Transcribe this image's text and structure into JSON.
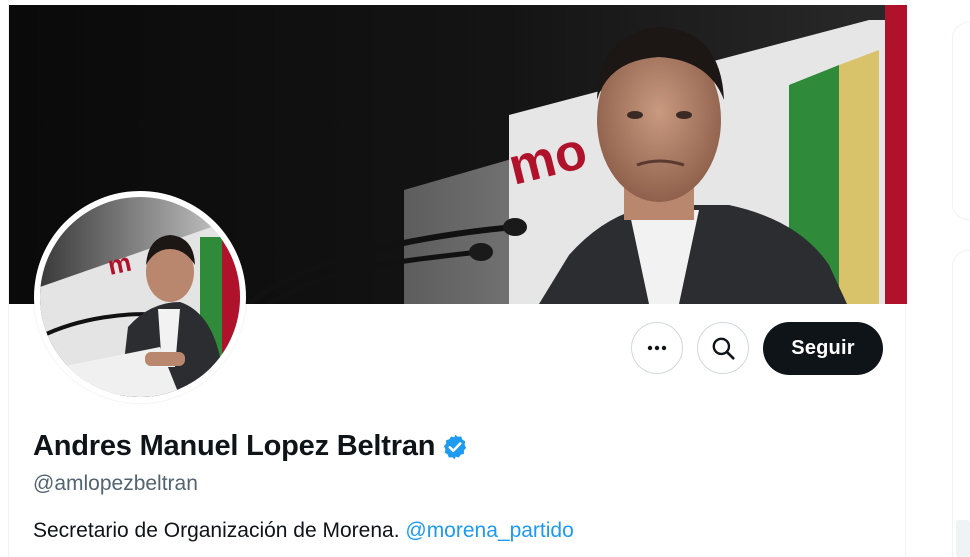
{
  "profile": {
    "display_name": "Andres Manuel Lopez Beltran",
    "handle": "@amlopezbeltran",
    "bio_text": "Secretario de Organización de Morena. ",
    "bio_mention": "@morena_partido",
    "verified": true
  },
  "actions": {
    "more_icon": "more-horizontal-icon",
    "search_icon": "search-icon",
    "follow_label": "Seguir"
  },
  "banner": {
    "signage_text": "mo"
  },
  "colors": {
    "accent": "#1d9bf0",
    "follow_button_bg": "#0f1419",
    "muted_text": "#536471",
    "brand_red": "#b0122b"
  }
}
